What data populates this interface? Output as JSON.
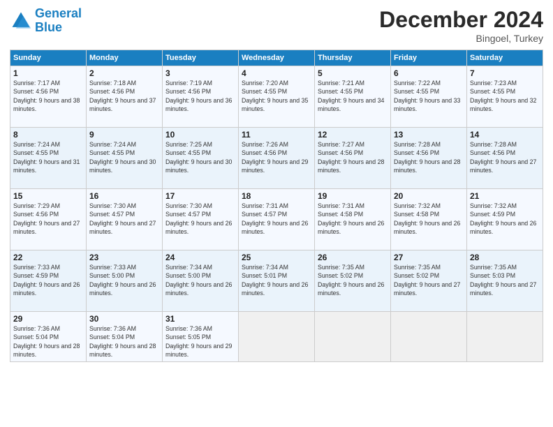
{
  "header": {
    "logo_line1": "General",
    "logo_line2": "Blue",
    "month": "December 2024",
    "location": "Bingoel, Turkey"
  },
  "weekdays": [
    "Sunday",
    "Monday",
    "Tuesday",
    "Wednesday",
    "Thursday",
    "Friday",
    "Saturday"
  ],
  "weeks": [
    [
      {
        "day": "1",
        "sunrise": "7:17 AM",
        "sunset": "4:56 PM",
        "daylight": "9 hours and 38 minutes."
      },
      {
        "day": "2",
        "sunrise": "7:18 AM",
        "sunset": "4:56 PM",
        "daylight": "9 hours and 37 minutes."
      },
      {
        "day": "3",
        "sunrise": "7:19 AM",
        "sunset": "4:56 PM",
        "daylight": "9 hours and 36 minutes."
      },
      {
        "day": "4",
        "sunrise": "7:20 AM",
        "sunset": "4:55 PM",
        "daylight": "9 hours and 35 minutes."
      },
      {
        "day": "5",
        "sunrise": "7:21 AM",
        "sunset": "4:55 PM",
        "daylight": "9 hours and 34 minutes."
      },
      {
        "day": "6",
        "sunrise": "7:22 AM",
        "sunset": "4:55 PM",
        "daylight": "9 hours and 33 minutes."
      },
      {
        "day": "7",
        "sunrise": "7:23 AM",
        "sunset": "4:55 PM",
        "daylight": "9 hours and 32 minutes."
      }
    ],
    [
      {
        "day": "8",
        "sunrise": "7:24 AM",
        "sunset": "4:55 PM",
        "daylight": "9 hours and 31 minutes."
      },
      {
        "day": "9",
        "sunrise": "7:24 AM",
        "sunset": "4:55 PM",
        "daylight": "9 hours and 30 minutes."
      },
      {
        "day": "10",
        "sunrise": "7:25 AM",
        "sunset": "4:55 PM",
        "daylight": "9 hours and 30 minutes."
      },
      {
        "day": "11",
        "sunrise": "7:26 AM",
        "sunset": "4:56 PM",
        "daylight": "9 hours and 29 minutes."
      },
      {
        "day": "12",
        "sunrise": "7:27 AM",
        "sunset": "4:56 PM",
        "daylight": "9 hours and 28 minutes."
      },
      {
        "day": "13",
        "sunrise": "7:28 AM",
        "sunset": "4:56 PM",
        "daylight": "9 hours and 28 minutes."
      },
      {
        "day": "14",
        "sunrise": "7:28 AM",
        "sunset": "4:56 PM",
        "daylight": "9 hours and 27 minutes."
      }
    ],
    [
      {
        "day": "15",
        "sunrise": "7:29 AM",
        "sunset": "4:56 PM",
        "daylight": "9 hours and 27 minutes."
      },
      {
        "day": "16",
        "sunrise": "7:30 AM",
        "sunset": "4:57 PM",
        "daylight": "9 hours and 27 minutes."
      },
      {
        "day": "17",
        "sunrise": "7:30 AM",
        "sunset": "4:57 PM",
        "daylight": "9 hours and 26 minutes."
      },
      {
        "day": "18",
        "sunrise": "7:31 AM",
        "sunset": "4:57 PM",
        "daylight": "9 hours and 26 minutes."
      },
      {
        "day": "19",
        "sunrise": "7:31 AM",
        "sunset": "4:58 PM",
        "daylight": "9 hours and 26 minutes."
      },
      {
        "day": "20",
        "sunrise": "7:32 AM",
        "sunset": "4:58 PM",
        "daylight": "9 hours and 26 minutes."
      },
      {
        "day": "21",
        "sunrise": "7:32 AM",
        "sunset": "4:59 PM",
        "daylight": "9 hours and 26 minutes."
      }
    ],
    [
      {
        "day": "22",
        "sunrise": "7:33 AM",
        "sunset": "4:59 PM",
        "daylight": "9 hours and 26 minutes."
      },
      {
        "day": "23",
        "sunrise": "7:33 AM",
        "sunset": "5:00 PM",
        "daylight": "9 hours and 26 minutes."
      },
      {
        "day": "24",
        "sunrise": "7:34 AM",
        "sunset": "5:00 PM",
        "daylight": "9 hours and 26 minutes."
      },
      {
        "day": "25",
        "sunrise": "7:34 AM",
        "sunset": "5:01 PM",
        "daylight": "9 hours and 26 minutes."
      },
      {
        "day": "26",
        "sunrise": "7:35 AM",
        "sunset": "5:02 PM",
        "daylight": "9 hours and 26 minutes."
      },
      {
        "day": "27",
        "sunrise": "7:35 AM",
        "sunset": "5:02 PM",
        "daylight": "9 hours and 27 minutes."
      },
      {
        "day": "28",
        "sunrise": "7:35 AM",
        "sunset": "5:03 PM",
        "daylight": "9 hours and 27 minutes."
      }
    ],
    [
      {
        "day": "29",
        "sunrise": "7:36 AM",
        "sunset": "5:04 PM",
        "daylight": "9 hours and 28 minutes."
      },
      {
        "day": "30",
        "sunrise": "7:36 AM",
        "sunset": "5:04 PM",
        "daylight": "9 hours and 28 minutes."
      },
      {
        "day": "31",
        "sunrise": "7:36 AM",
        "sunset": "5:05 PM",
        "daylight": "9 hours and 29 minutes."
      },
      null,
      null,
      null,
      null
    ]
  ]
}
